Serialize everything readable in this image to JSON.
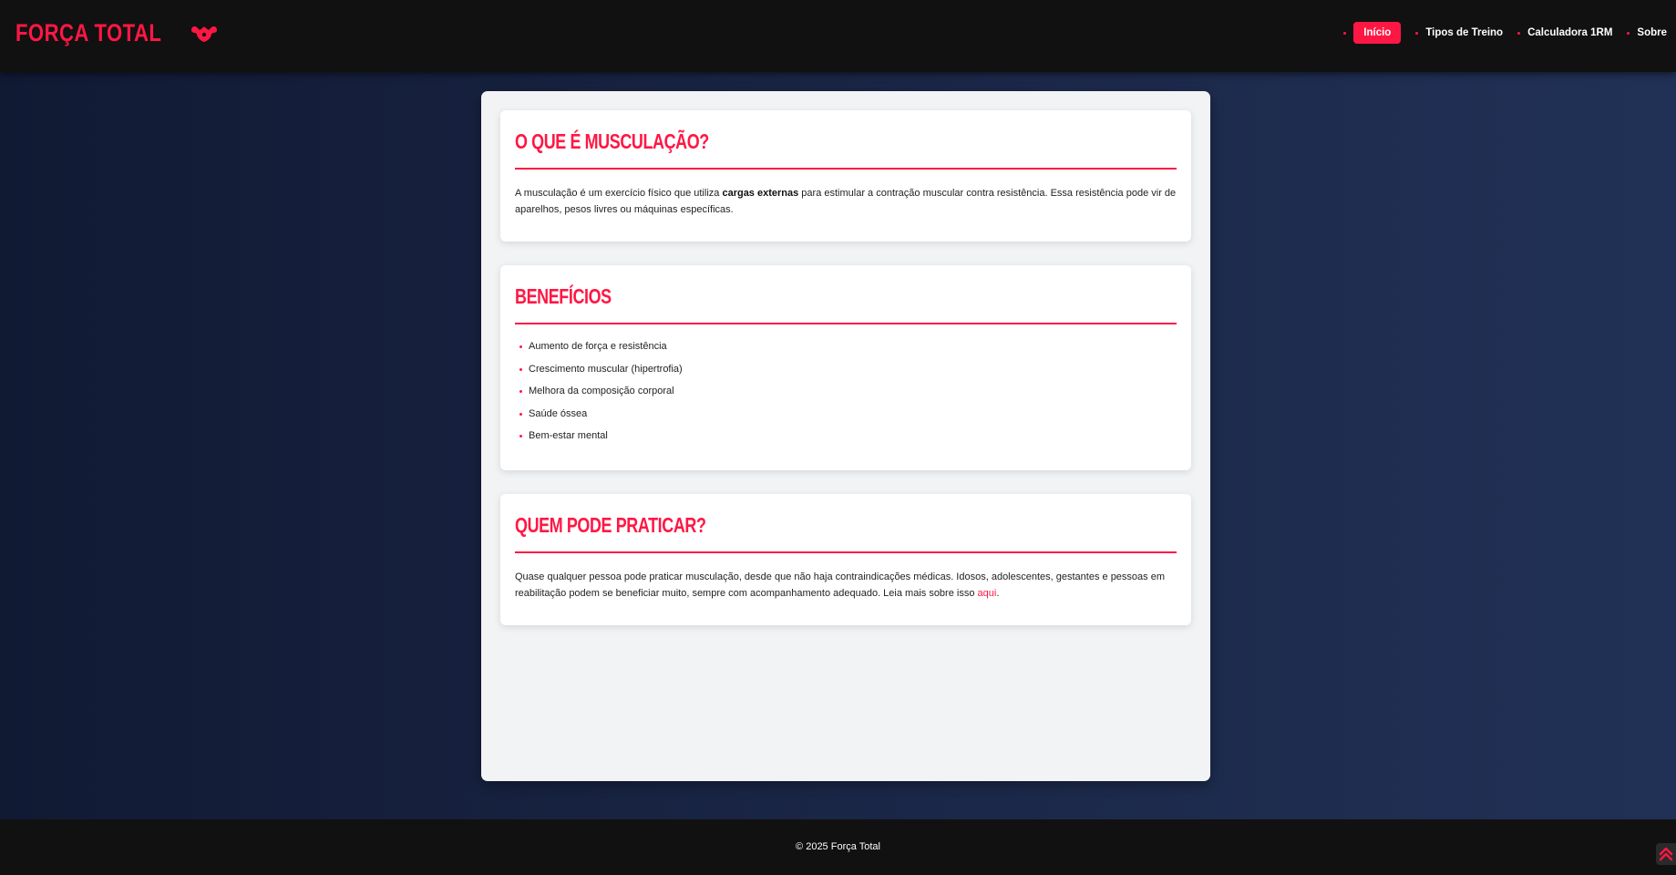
{
  "brand": {
    "title": "Força Total",
    "icon": "flexed-arm-icon",
    "color": "#ff1744"
  },
  "nav": {
    "items": [
      {
        "label": "Início",
        "active": true
      },
      {
        "label": "Tipos de Treino",
        "active": false
      },
      {
        "label": "Calculadora 1RM",
        "active": false
      },
      {
        "label": "Sobre",
        "active": false
      }
    ]
  },
  "sections": {
    "what_is": {
      "title": "O que é Musculação?",
      "text_before": "A musculação é um exercício físico que utiliza ",
      "text_bold": "cargas externas",
      "text_after": " para estimular a contração muscular contra resistência. Essa resistência pode vir de aparelhos, pesos livres ou máquinas específicas."
    },
    "benefits": {
      "title": "Benefícios",
      "items": [
        "Aumento de força e resistência",
        "Crescimento muscular (hipertrofia)",
        "Melhora da composição corporal",
        "Saúde óssea",
        "Bem-estar mental"
      ]
    },
    "who": {
      "title": "Quem pode praticar?",
      "text_before": "Quase qualquer pessoa pode praticar musculação, desde que não haja contraindicações médicas. Idosos, adolescentes, gestantes e pessoas em reabilitação podem se beneficiar muito, sempre com acompanhamento adequado. Leia mais sobre isso ",
      "link": "aqui",
      "text_after": "."
    }
  },
  "footer": {
    "text": "© 2025 Força Total"
  },
  "scroll_top": {
    "icon": "double-chevron-up-icon"
  },
  "colors": {
    "accent": "#ff1744",
    "header_bg": "#111111",
    "panel_bg": "#f2f3f5",
    "page_bg_start": "#111a33",
    "page_bg_end": "#213156"
  }
}
